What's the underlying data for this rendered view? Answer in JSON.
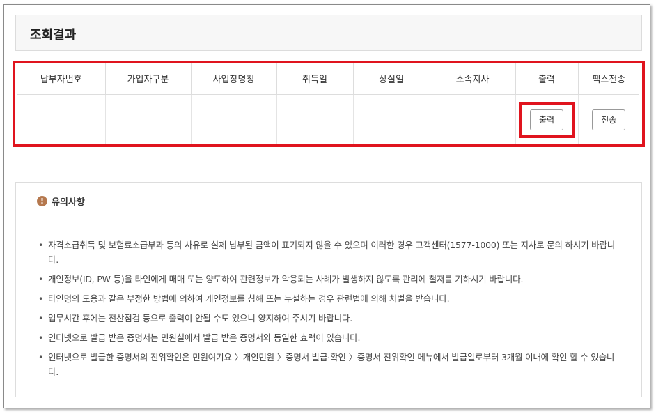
{
  "result": {
    "title": "조회결과"
  },
  "table": {
    "columns": [
      "납부자번호",
      "가입자구분",
      "사업장명칭",
      "취득일",
      "상실일",
      "소속지사",
      "출력",
      "팩스전송"
    ],
    "row": {
      "print_button": "출력",
      "fax_button": "전송"
    }
  },
  "notice": {
    "icon": "warning-circle-icon",
    "title": "유의사항",
    "items": [
      "자격소급취득 및 보험료소급부과 등의 사유로 실제 납부된 금액이 표기되지 않을 수 있으며 이러한 경우 고객센터(1577-1000) 또는 지사로 문의 하시기 바랍니다.",
      "개인정보(ID, PW 등)을 타인에게 매매 또는 양도하여 관련정보가 악용되는 사례가 발생하지 않도록 관리에 철저를 기하시기 바랍니다.",
      "타인명의 도용과 같은 부정한 방법에 의하여 개인정보를 침해 또는 누설하는 경우 관련법에 의해 처벌을 받습니다.",
      "업무시간 후에는 전산점검 등으로 출력이 안될 수도 있으니 양지하여 주시기 바랍니다.",
      "인터넷으로 발급 받은 증명서는 민원실에서 발급 받은 증명서와 동일한 효력이 있습니다.",
      "인터넷으로 발급한 증명서의 진위확인은 민원여기요 〉개인민원 〉증명서 발급·확인 〉증명서 진위확인 메뉴에서 발급일로부터 3개월 이내에 확인 할 수 있습니다."
    ]
  },
  "colors": {
    "highlight": "#e0141e",
    "warn_icon": "#b5784e"
  }
}
